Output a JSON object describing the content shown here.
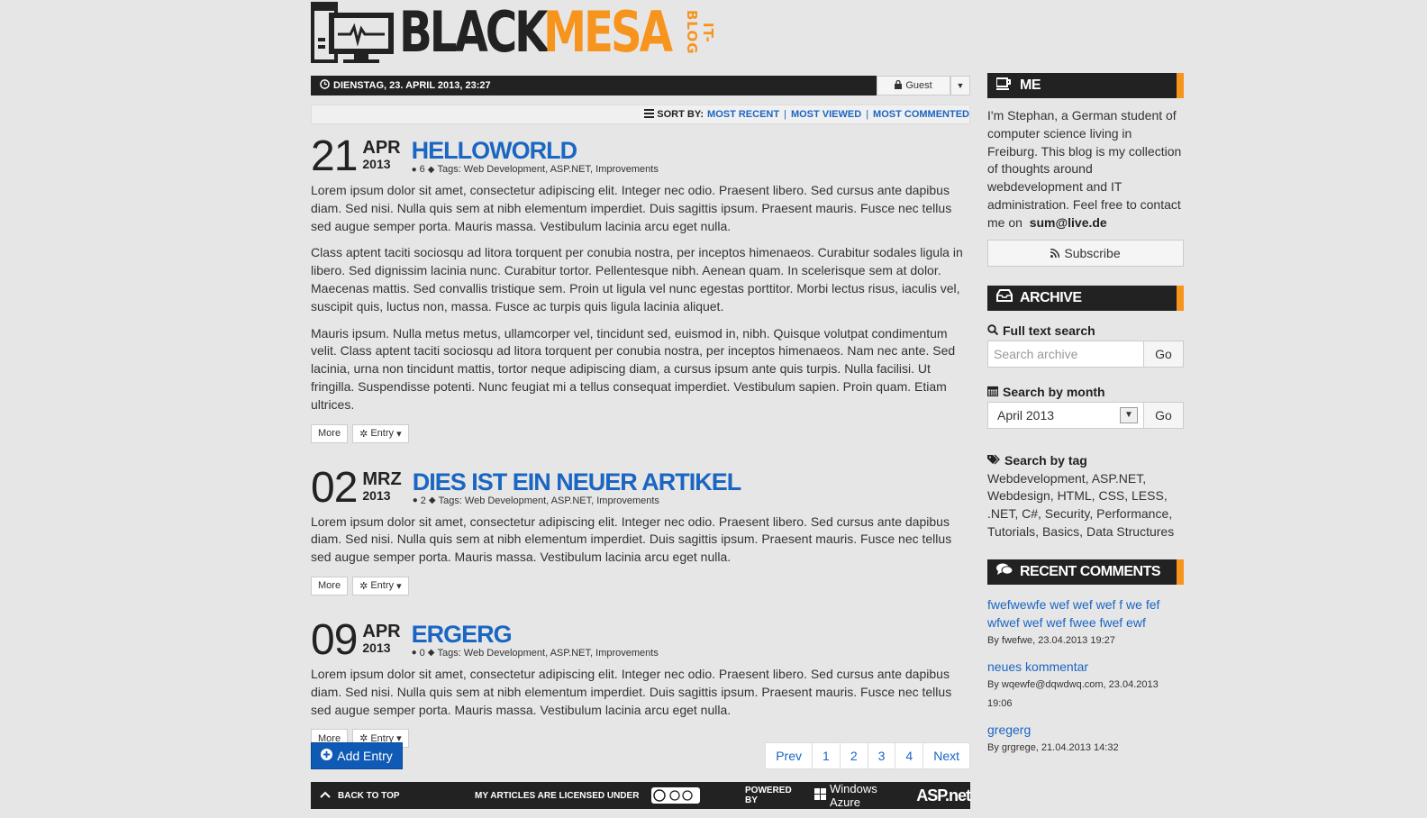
{
  "logo": {
    "word_black": "BLACK",
    "word_orange": "MESA",
    "tagline": "IT-BLOG"
  },
  "topbar": {
    "date": "DIENSTAG, 23. APRIL 2013, 23:27",
    "user": "Guest"
  },
  "sort": {
    "label": "SORT BY:",
    "options": [
      "MOST RECENT",
      "MOST VIEWED",
      "MOST COMMENTED"
    ]
  },
  "entries": [
    {
      "day": "21",
      "month": "APR",
      "year": "2013",
      "title": "HELLOWORLD",
      "comments": "6",
      "tags_label": "Tags:",
      "tags": "Web Development, ASP.NET, Improvements",
      "paragraphs": [
        "Lorem ipsum dolor sit amet, consectetur adipiscing elit. Integer nec odio. Praesent libero. Sed cursus ante dapibus diam. Sed nisi. Nulla quis sem at nibh elementum imperdiet. Duis sagittis ipsum. Praesent mauris. Fusce nec tellus sed augue semper porta. Mauris massa. Vestibulum lacinia arcu eget nulla.",
        "Class aptent taciti sociosqu ad litora torquent per conubia nostra, per inceptos himenaeos. Curabitur sodales ligula in libero. Sed dignissim lacinia nunc. Curabitur tortor. Pellentesque nibh. Aenean quam. In scelerisque sem at dolor. Maecenas mattis. Sed convallis tristique sem. Proin ut ligula vel nunc egestas porttitor. Morbi lectus risus, iaculis vel, suscipit quis, luctus non, massa. Fusce ac turpis quis ligula lacinia aliquet.",
        "Mauris ipsum. Nulla metus metus, ullamcorper vel, tincidunt sed, euismod in, nibh. Quisque volutpat condimentum velit. Class aptent taciti sociosqu ad litora torquent per conubia nostra, per inceptos himenaeos. Nam nec ante. Sed lacinia, urna non tincidunt mattis, tortor neque adipiscing diam, a cursus ipsum ante quis turpis. Nulla facilisi. Ut fringilla. Suspendisse potenti. Nunc feugiat mi a tellus consequat imperdiet. Vestibulum sapien. Proin quam. Etiam ultrices."
      ],
      "more_label": "More",
      "entry_label": "Entry"
    },
    {
      "day": "02",
      "month": "MRZ",
      "year": "2013",
      "title": "DIES IST EIN NEUER ARTIKEL",
      "comments": "2",
      "tags_label": "Tags:",
      "tags": "Web Development, ASP.NET, Improvements",
      "paragraphs": [
        "Lorem ipsum dolor sit amet, consectetur adipiscing elit. Integer nec odio. Praesent libero. Sed cursus ante dapibus diam. Sed nisi. Nulla quis sem at nibh elementum imperdiet. Duis sagittis ipsum. Praesent mauris. Fusce nec tellus sed augue semper porta. Mauris massa. Vestibulum lacinia arcu eget nulla."
      ],
      "more_label": "More",
      "entry_label": "Entry"
    },
    {
      "day": "09",
      "month": "APR",
      "year": "2013",
      "title": "ERGERG",
      "comments": "0",
      "tags_label": "Tags:",
      "tags": "Web Development, ASP.NET, Improvements",
      "paragraphs": [
        "Lorem ipsum dolor sit amet, consectetur adipiscing elit. Integer nec odio. Praesent libero. Sed cursus ante dapibus diam. Sed nisi. Nulla quis sem at nibh elementum imperdiet. Duis sagittis ipsum. Praesent mauris. Fusce nec tellus sed augue semper porta. Mauris massa. Vestibulum lacinia arcu eget nulla."
      ],
      "more_label": "More",
      "entry_label": "Entry"
    }
  ],
  "add_entry": "Add Entry",
  "pager": [
    "Prev",
    "1",
    "2",
    "3",
    "4",
    "Next"
  ],
  "footer": {
    "back_to_top": "BACK TO TOP",
    "license": "MY ARTICLES ARE LICENSED UNDER",
    "powered_by": "POWERED BY",
    "azure": "Windows Azure",
    "aspnet": "ASP.net"
  },
  "sidebar": {
    "me": {
      "title": "ME",
      "text": "I'm Stephan, a German student of computer science living in Freiburg. This blog is my collection of thoughts around webdevelopment and IT administration. Feel free to contact me on",
      "email": "sum@live.de",
      "subscribe": "Subscribe"
    },
    "archive": {
      "title": "ARCHIVE",
      "fulltext_label": "Full text search",
      "search_placeholder": "Search archive",
      "go": "Go",
      "month_label": "Search by month",
      "month_value": "April 2013",
      "tag_label": "Search by tag",
      "tags": "Webdevelopment, ASP.NET, Webdesign, HTML, CSS, LESS, .NET, C#, Security, Performance, Tutorials, Basics, Data Structures"
    },
    "recent": {
      "title": "RECENT COMMENTS",
      "items": [
        {
          "text": "fwefwewfe wef wef wef f we fef wfwef wef wef fwee fwef ewf",
          "by": "By fwefwe, 23.04.2013 19:27"
        },
        {
          "text": "neues kommentar",
          "by": "By wqewfe@dqwdwq.com, 23.04.2013 19:06"
        },
        {
          "text": "gregerg",
          "by": "By grgrege, 21.04.2013 14:32"
        }
      ]
    }
  },
  "colors": {
    "accent": "#f7941d",
    "link": "#1a66c2",
    "dark": "#222222"
  }
}
